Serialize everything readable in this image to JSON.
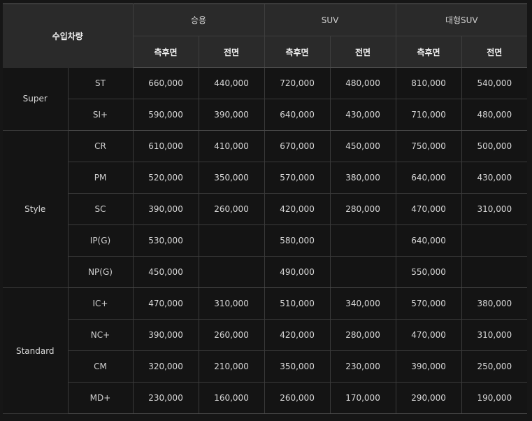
{
  "header": {
    "corner": "수입차량",
    "groups": [
      "승용",
      "SUV",
      "대형SUV"
    ],
    "sub": [
      "측후면",
      "전면",
      "측후면",
      "전면",
      "측후면",
      "전면"
    ]
  },
  "rows": [
    {
      "category": "Super",
      "type": "ST",
      "v": [
        "660,000",
        "440,000",
        "720,000",
        "480,000",
        "810,000",
        "540,000"
      ]
    },
    {
      "category": "Super",
      "type": "SI+",
      "v": [
        "590,000",
        "390,000",
        "640,000",
        "430,000",
        "710,000",
        "480,000"
      ]
    },
    {
      "category": "Style",
      "type": "CR",
      "v": [
        "610,000",
        "410,000",
        "670,000",
        "450,000",
        "750,000",
        "500,000"
      ]
    },
    {
      "category": "Style",
      "type": "PM",
      "v": [
        "520,000",
        "350,000",
        "570,000",
        "380,000",
        "640,000",
        "430,000"
      ]
    },
    {
      "category": "Style",
      "type": "SC",
      "v": [
        "390,000",
        "260,000",
        "420,000",
        "280,000",
        "470,000",
        "310,000"
      ]
    },
    {
      "category": "Style",
      "type": "IP(G)",
      "v": [
        "530,000",
        "",
        "580,000",
        "",
        "640,000",
        ""
      ]
    },
    {
      "category": "Style",
      "type": "NP(G)",
      "v": [
        "450,000",
        "",
        "490,000",
        "",
        "550,000",
        ""
      ]
    },
    {
      "category": "Standard",
      "type": "IC+",
      "v": [
        "470,000",
        "310,000",
        "510,000",
        "340,000",
        "570,000",
        "380,000"
      ]
    },
    {
      "category": "Standard",
      "type": "NC+",
      "v": [
        "390,000",
        "260,000",
        "420,000",
        "280,000",
        "470,000",
        "310,000"
      ]
    },
    {
      "category": "Standard",
      "type": "CM",
      "v": [
        "320,000",
        "210,000",
        "350,000",
        "230,000",
        "390,000",
        "250,000"
      ]
    },
    {
      "category": "Standard",
      "type": "MD+",
      "v": [
        "230,000",
        "160,000",
        "260,000",
        "170,000",
        "290,000",
        "190,000"
      ]
    }
  ],
  "colors": {
    "header_bg": "#2a2a2a",
    "body_bg": "#141414",
    "text": "#d8d8d8",
    "border": "#3a3a3a"
  }
}
